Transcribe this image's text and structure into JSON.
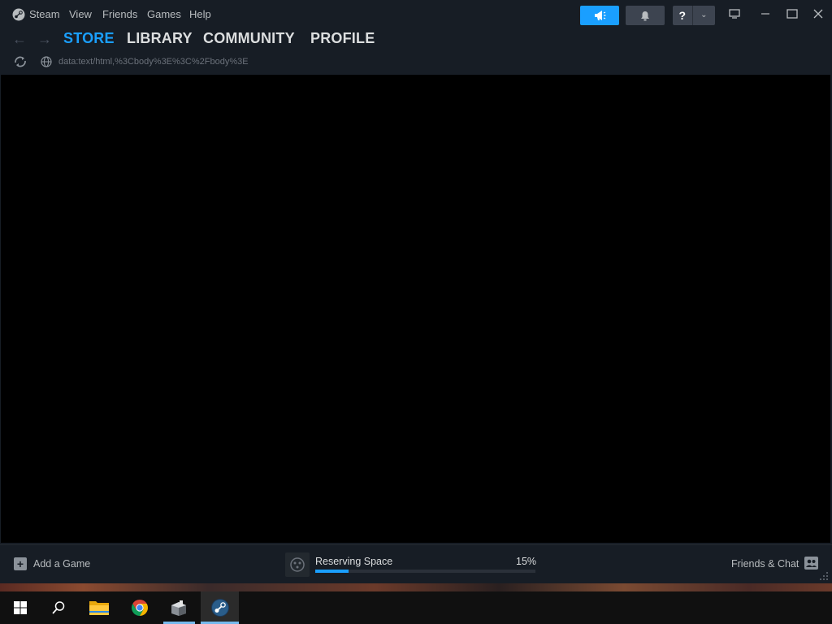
{
  "menu": {
    "steam": "Steam",
    "view": "View",
    "friends": "Friends",
    "games": "Games",
    "help": "Help"
  },
  "header_buttons": {
    "help_label": "?"
  },
  "nav": {
    "tabs": [
      "STORE",
      "LIBRARY",
      "COMMUNITY",
      "PROFILE"
    ],
    "active_tab": "STORE"
  },
  "url_bar": {
    "url": "data:text/html,%3Cbody%3E%3C%2Fbody%3E"
  },
  "bottom_bar": {
    "add_game": "Add a Game",
    "download_status": "Reserving Space",
    "download_percent": "15%",
    "download_progress": 0.15,
    "friends_chat": "Friends & Chat"
  },
  "colors": {
    "accent": "#1a9fff",
    "background": "#171d25",
    "content": "#000000"
  },
  "taskbar": {
    "items": [
      "windows-start",
      "search",
      "file-explorer",
      "chrome",
      "app",
      "steam"
    ]
  }
}
